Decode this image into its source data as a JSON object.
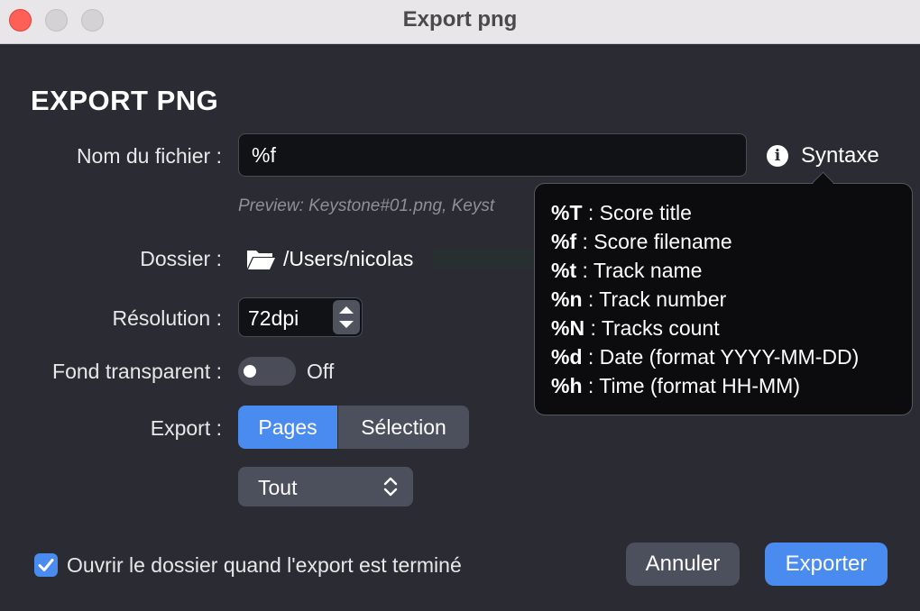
{
  "window": {
    "title": "Export png"
  },
  "heading": "EXPORT PNG",
  "filename": {
    "label": "Nom du fichier :",
    "value": "%f",
    "syntax_label": "Syntaxe",
    "preview": "Preview: Keystone#01.png, Keyst"
  },
  "folder": {
    "label": "Dossier :",
    "path": "/Users/nicolas"
  },
  "resolution": {
    "label": "Résolution :",
    "value": "72dpi"
  },
  "transparent": {
    "label": "Fond transparent :",
    "state": "Off"
  },
  "export": {
    "label": "Export :",
    "options": [
      "Pages",
      "Sélection"
    ],
    "selected": "Pages",
    "range_value": "Tout"
  },
  "open_folder": {
    "label": "Ouvrir le dossier quand l'export est terminé",
    "checked": true
  },
  "buttons": {
    "cancel": "Annuler",
    "export": "Exporter"
  },
  "tooltip": {
    "items": [
      {
        "code": "%T",
        "desc": " : Score title"
      },
      {
        "code": "%f",
        "desc": " : Score filename"
      },
      {
        "code": "%t",
        "desc": " : Track name"
      },
      {
        "code": "%n",
        "desc": " : Track number"
      },
      {
        "code": "%N",
        "desc": " : Tracks count"
      },
      {
        "code": "%d",
        "desc": " : Date (format YYYY-MM-DD)"
      },
      {
        "code": "%h",
        "desc": " : Time (format HH-MM)"
      }
    ]
  },
  "colors": {
    "accent": "#4a8bf0",
    "background": "#2b2c33"
  }
}
